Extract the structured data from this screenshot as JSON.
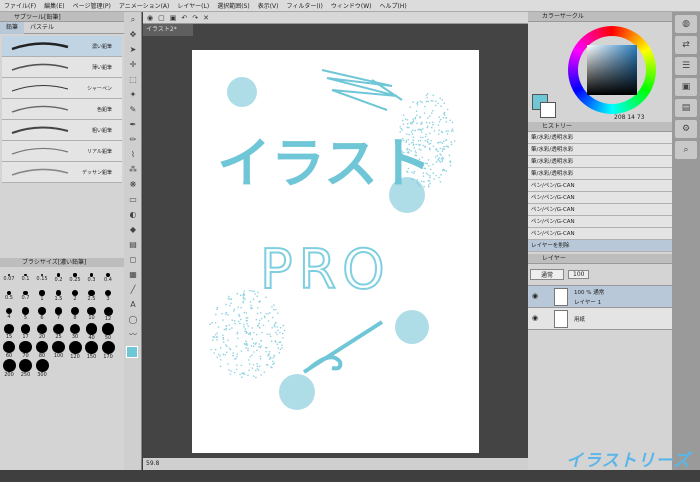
{
  "menu": [
    "ファイル(F)",
    "編集(E)",
    "ページ管理(P)",
    "アニメーション(A)",
    "レイヤー(L)",
    "選択範囲(S)",
    "表示(V)",
    "フィルター(I)",
    "ウィンドウ(W)",
    "ヘルプ(H)"
  ],
  "subtool": {
    "title": "サブツール[鉛筆]",
    "tabs": [
      "鉛筆",
      "パステル"
    ],
    "brushes": [
      "濃い鉛筆",
      "薄い鉛筆",
      "シャーペン",
      "色鉛筆",
      "粗い鉛筆",
      "リアル鉛筆",
      "デッサン鉛筆"
    ]
  },
  "brush_size": {
    "title": "ブラシサイズ[濃い鉛筆]",
    "sizes": [
      "0.07",
      "0.1",
      "0.15",
      "0.2",
      "0.25",
      "0.3",
      "0.4",
      "0.5",
      "0.7",
      "1",
      "1.5",
      "2",
      "2.5",
      "3",
      "4",
      "5",
      "6",
      "7",
      "8",
      "10",
      "12",
      "15",
      "17",
      "20",
      "25",
      "30",
      "40",
      "50",
      "60",
      "70",
      "80",
      "100",
      "120",
      "150",
      "170",
      "200",
      "250",
      "300"
    ]
  },
  "canvas": {
    "tab": "イラスト2*",
    "zoom": "59.8",
    "art_title": "イラスト",
    "art_sub": "PRO"
  },
  "color": {
    "panel": "カラーサークル",
    "main": "#6ec6d6",
    "sub": "#5aa8c8",
    "values": "208 14 73"
  },
  "history": {
    "title": "ヒストリー",
    "items": [
      "筆/水彩/透明水彩",
      "筆/水彩/透明水彩",
      "筆/水彩/透明水彩",
      "筆/水彩/透明水彩",
      "ペン/ペン/G-CAN",
      "ペン/ペン/G-CAN",
      "ペン/ペン/G-CAN",
      "ペン/ペン/G-CAN",
      "ペン/ペン/G-CAN",
      "レイヤーを削除"
    ]
  },
  "layers": {
    "title": "レイヤー",
    "blend": "通常",
    "opacity": "100",
    "items": [
      {
        "label": "100 % 通常",
        "name": "レイヤー 1"
      },
      {
        "label": "",
        "name": "用紙"
      }
    ]
  },
  "watermark": "イラストリーズ"
}
